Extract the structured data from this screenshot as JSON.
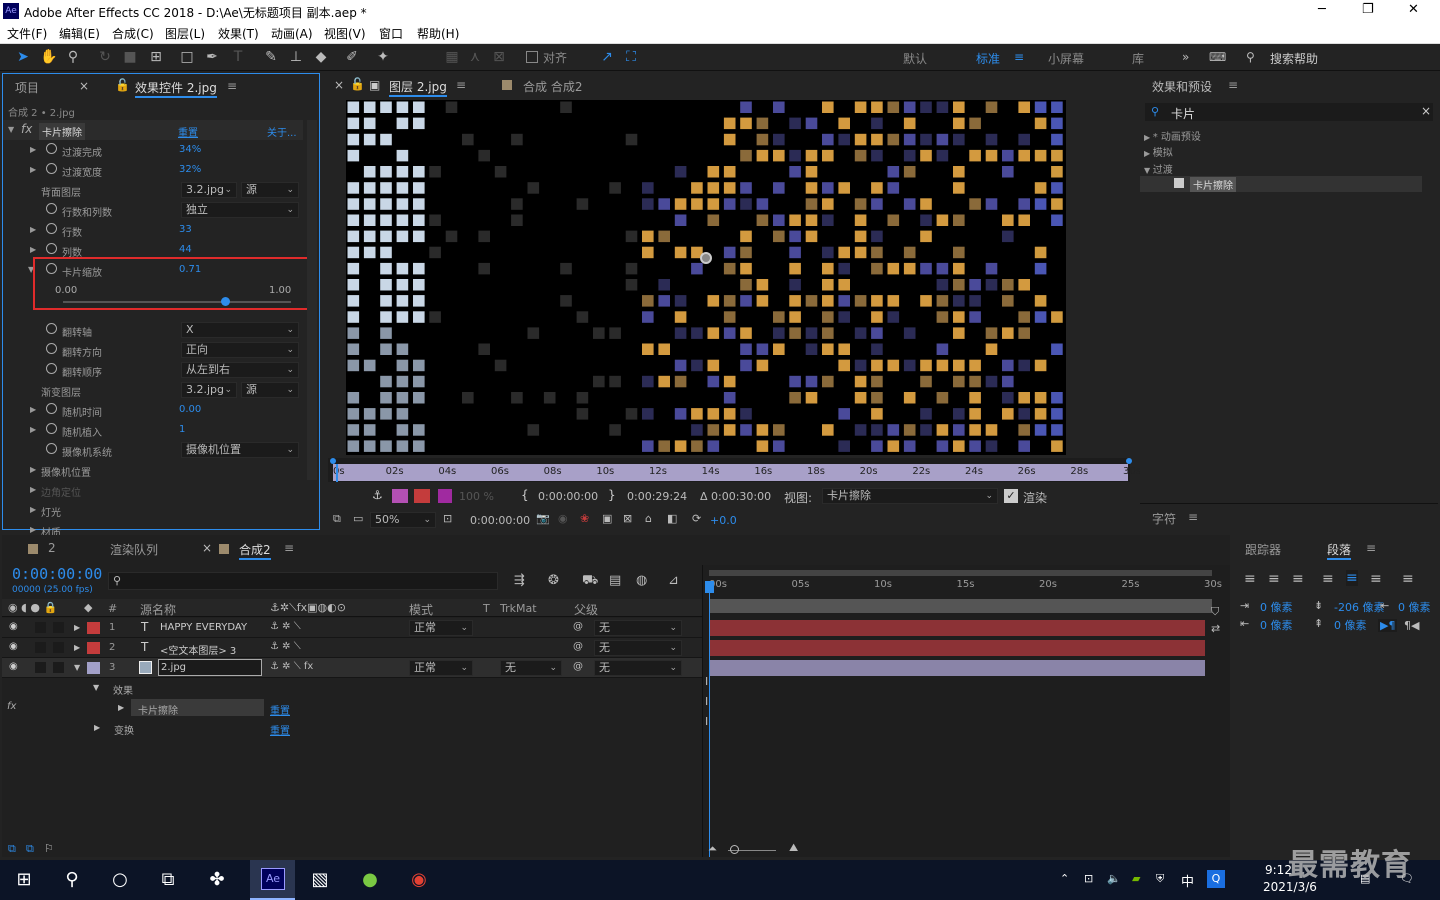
{
  "titlebar": {
    "app_icon": "Ae",
    "title": "Adobe After Effects CC 2018 - D:\\Ae\\无标题项目 副本.aep *",
    "min": "─",
    "max": "❐",
    "close": "✕"
  },
  "menu": [
    "文件(F)",
    "编辑(E)",
    "合成(C)",
    "图层(L)",
    "效果(T)",
    "动画(A)",
    "视图(V)",
    "窗口",
    "帮助(H)"
  ],
  "toolbar": {
    "align": "对齐",
    "workspaces": [
      "默认",
      "标准",
      "小屏幕",
      "库"
    ],
    "active_ws": "标准",
    "search": "搜索帮助"
  },
  "effect_panel": {
    "tab_project": "项目",
    "tab_effects": "效果控件 2.jpg",
    "breadcrumb": "合成 2 • 2.jpg",
    "effect_name": "卡片擦除",
    "reset": "重置",
    "about": "关于...",
    "rows": [
      {
        "label": "过渡完成",
        "value": "34%",
        "stop": true,
        "tri": true
      },
      {
        "label": "过渡宽度",
        "value": "32%",
        "stop": true,
        "tri": true
      },
      {
        "label": "背面图层",
        "value": "",
        "dd1": "3.2.jpg",
        "dd2": "源"
      },
      {
        "label": "行数和列数",
        "value": "",
        "dd1": "独立",
        "stop": true
      },
      {
        "label": "行数",
        "value": "33",
        "stop": true,
        "tri": true
      },
      {
        "label": "列数",
        "value": "44",
        "stop": true,
        "tri": true
      },
      {
        "label": "卡片缩放",
        "value": "0.71",
        "stop": true,
        "tri": true
      },
      {
        "label": "",
        "value": ""
      },
      {
        "label": "",
        "value": ""
      },
      {
        "label": "翻转轴",
        "value": "",
        "dd1": "X",
        "stop": true
      },
      {
        "label": "翻转方向",
        "value": "",
        "dd1": "正向",
        "stop": true
      },
      {
        "label": "翻转顺序",
        "value": "",
        "dd1": "从左到右",
        "stop": true
      },
      {
        "label": "渐变图层",
        "value": "",
        "dd1": "3.2.jpg",
        "dd2": "源"
      },
      {
        "label": "随机时间",
        "value": "0.00",
        "stop": true,
        "tri": true
      },
      {
        "label": "随机植入",
        "value": "1",
        "stop": true,
        "tri": true
      },
      {
        "label": "摄像机系统",
        "value": "",
        "dd1": "摄像机位置",
        "stop": true
      },
      {
        "label": "摄像机位置",
        "value": "",
        "tri": true
      },
      {
        "label": "边角定位",
        "value": "",
        "tri": true,
        "dim": true
      },
      {
        "label": "灯光",
        "value": "",
        "tri": true
      },
      {
        "label": "材质",
        "value": "",
        "tri": true
      }
    ],
    "slider_min": "0.00",
    "slider_max": "1.00",
    "slider_value": 0.71
  },
  "viewer": {
    "tab_layer": "图层 2.jpg",
    "tab_comp": "合成 合成2",
    "ruler": [
      "0s",
      "02s",
      "04s",
      "06s",
      "08s",
      "10s",
      "12s",
      "14s",
      "16s",
      "18s",
      "20s",
      "22s",
      "24s",
      "26s",
      "28s",
      "30s"
    ],
    "opacity": "100 %",
    "in_time": "0:00:00:00",
    "out_time": "0:00:29:24",
    "dur": "Δ 0:00:30:00",
    "view_label": "视图:",
    "view_value": "卡片擦除",
    "render": "渲染",
    "zoom": "50%",
    "cur_time": "0:00:00:00",
    "exposure": "+0.0"
  },
  "right_panel": {
    "title": "效果和预设",
    "search": "卡片",
    "tree": [
      "* 动画预设",
      "模拟",
      "过渡"
    ],
    "item": "卡片擦除",
    "char_title": "字符"
  },
  "timeline": {
    "tabs": [
      "2",
      "渲染队列",
      "合成2"
    ],
    "timecode": "0:00:00:00",
    "fps": "00000 (25.00 fps)",
    "col_headers": {
      "num": "#",
      "name": "源名称",
      "mode": "模式",
      "t": "T",
      "trkmat": "TrkMat",
      "parent": "父级"
    },
    "layers": [
      {
        "num": "1",
        "type": "T",
        "name": "HAPPY EVERYDAY",
        "mode": "正常",
        "parent": "无",
        "color": "#c43c3c"
      },
      {
        "num": "2",
        "type": "T",
        "name": "<空文本图层> 3",
        "mode": "",
        "parent": "无",
        "color": "#c43c3c"
      },
      {
        "num": "3",
        "type": "img",
        "name": "2.jpg",
        "mode": "正常",
        "trk": "无",
        "parent": "无",
        "color": "#a2a0c8"
      }
    ],
    "sub": {
      "effects": "效果",
      "effect_item": "卡片擦除",
      "reset": "重置",
      "transform": "变换",
      "reset2": "重置"
    },
    "ruler": [
      "00s",
      "05s",
      "10s",
      "15s",
      "20s",
      "25s",
      "30s"
    ]
  },
  "para_panel": {
    "tab_tracker": "跟踪器",
    "tab_para": "段落",
    "v1": "0 像素",
    "v2": "-206 像素",
    "v3": "0 像素",
    "v4": "0 像素",
    "v5": "0 像素"
  },
  "taskbar": {
    "time": "9:12",
    "date": "2021/3/6",
    "ime": "中",
    "watermark": "最需教育"
  }
}
